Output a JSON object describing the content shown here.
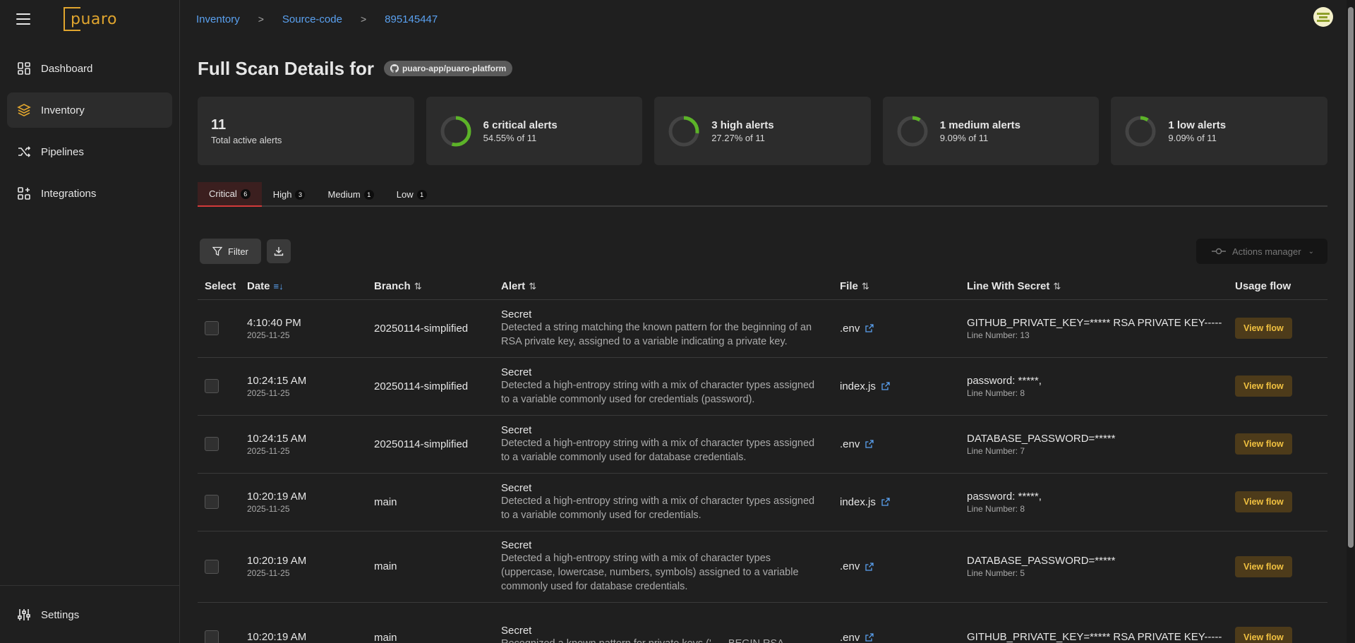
{
  "app": {
    "logo_text": "puaro"
  },
  "sidebar": {
    "items": [
      {
        "label": "Dashboard",
        "icon": "dashboard-icon"
      },
      {
        "label": "Inventory",
        "icon": "inventory-icon",
        "active": true
      },
      {
        "label": "Pipelines",
        "icon": "pipelines-icon"
      },
      {
        "label": "Integrations",
        "icon": "integrations-icon"
      }
    ],
    "settings_label": "Settings"
  },
  "breadcrumb": [
    "Inventory",
    "Source-code",
    "895145447"
  ],
  "page": {
    "title": "Full Scan Details for",
    "repo": "puaro-app/puaro-platform"
  },
  "summary": {
    "total": {
      "value": "11",
      "label": "Total active alerts"
    },
    "cards": [
      {
        "title": "6 critical alerts",
        "sub": "54.55% of 11",
        "fraction": 0.5455
      },
      {
        "title": "3 high alerts",
        "sub": "27.27% of 11",
        "fraction": 0.2727
      },
      {
        "title": "1 medium alerts",
        "sub": "9.09% of 11",
        "fraction": 0.0909
      },
      {
        "title": "1 low alerts",
        "sub": "9.09% of 11",
        "fraction": 0.0909
      }
    ],
    "ring_color": "#5cb328"
  },
  "tabs": [
    {
      "label": "Critical",
      "count": "6",
      "active": true
    },
    {
      "label": "High",
      "count": "3"
    },
    {
      "label": "Medium",
      "count": "1"
    },
    {
      "label": "Low",
      "count": "1"
    }
  ],
  "toolbar": {
    "filter_label": "Filter",
    "actions_label": "Actions manager"
  },
  "table": {
    "headers": {
      "select": "Select",
      "date": "Date",
      "branch": "Branch",
      "alert": "Alert",
      "file": "File",
      "line": "Line With Secret",
      "usage": "Usage flow"
    },
    "view_label": "View flow",
    "rows": [
      {
        "time": "4:10:40 PM",
        "date": "2025-11-25",
        "branch": "20250114-simplified",
        "alert": "Secret",
        "desc": "Detected a string matching the known pattern for the beginning of an RSA private key, assigned to a variable indicating a private key.",
        "file": ".env",
        "secret": "GITHUB_PRIVATE_KEY=***** RSA PRIVATE KEY-----",
        "line": "Line Number: 13"
      },
      {
        "time": "10:24:15 AM",
        "date": "2025-11-25",
        "branch": "20250114-simplified",
        "alert": "Secret",
        "desc": "Detected a high-entropy string with a mix of character types assigned to a variable commonly used for credentials (password).",
        "file": "index.js",
        "secret": "password: *****,",
        "line": "Line Number: 8"
      },
      {
        "time": "10:24:15 AM",
        "date": "2025-11-25",
        "branch": "20250114-simplified",
        "alert": "Secret",
        "desc": "Detected a high-entropy string with a mix of character types assigned to a variable commonly used for database credentials.",
        "file": ".env",
        "secret": "DATABASE_PASSWORD=*****",
        "line": "Line Number: 7"
      },
      {
        "time": "10:20:19 AM",
        "date": "2025-11-25",
        "branch": "main",
        "alert": "Secret",
        "desc": "Detected a high-entropy string with a mix of character types assigned to a variable commonly used for credentials.",
        "file": "index.js",
        "secret": "password: *****,",
        "line": "Line Number: 8"
      },
      {
        "time": "10:20:19 AM",
        "date": "2025-11-25",
        "branch": "main",
        "alert": "Secret",
        "desc": "Detected a high-entropy string with a mix of character types (uppercase, lowercase, numbers, symbols) assigned to a variable commonly used for database credentials.",
        "file": ".env",
        "secret": "DATABASE_PASSWORD=*****",
        "line": "Line Number: 5"
      },
      {
        "time": "10:20:19 AM",
        "date": "",
        "branch": "main",
        "alert": "Secret",
        "desc": "Recognized a known pattern for private keys ('-----BEGIN RSA",
        "file": ".env",
        "secret": "GITHUB_PRIVATE_KEY=***** RSA PRIVATE KEY-----",
        "line": ""
      }
    ]
  }
}
